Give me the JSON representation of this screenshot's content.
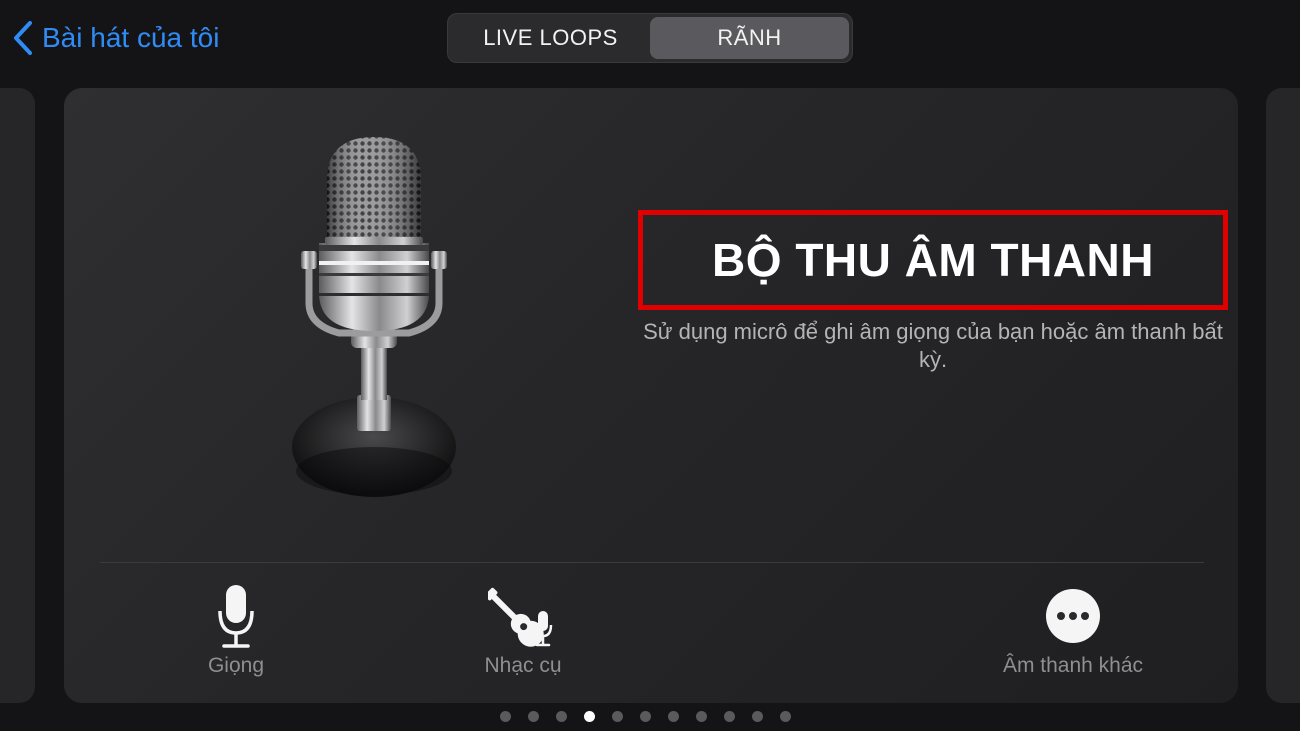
{
  "nav": {
    "back_label": "Bài hát của tôi"
  },
  "segment": {
    "tabs": [
      "LIVE LOOPS",
      "RÃNH"
    ],
    "selected": "RÃNH"
  },
  "card": {
    "title": "BỘ THU ÂM THANH",
    "description": "Sử dụng micrô để ghi âm giọng của bạn hoặc âm thanh bất kỳ.",
    "options": [
      {
        "label": "Giọng",
        "icon": "microphone-icon"
      },
      {
        "label": "Nhạc cụ",
        "icon": "guitar-mic-icon"
      },
      {
        "label": "Âm thanh khác",
        "icon": "more-icon"
      }
    ]
  },
  "pager": {
    "count": 11,
    "active_index": 3
  },
  "colors": {
    "accent": "#2f8cf7",
    "highlight_border": "#e00000",
    "background": "#141416"
  }
}
